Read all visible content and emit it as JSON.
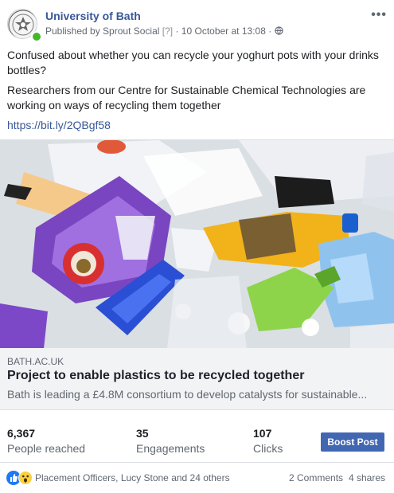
{
  "header": {
    "page_name": "University of Bath",
    "published_by": "Published by Sprout Social",
    "help_marker": "[?]",
    "separator": "·",
    "date": "10 October at 13:08",
    "audience_icon": "globe-icon",
    "more_label": "•••"
  },
  "post": {
    "paragraph1": "Confused about whether you can recycle your yoghurt pots with your drinks bottles?",
    "paragraph2": "Researchers from our Centre for Sustainable Chemical Technologies are working on ways of recycling them together",
    "link": "https://bit.ly/2QBgf58"
  },
  "link_preview": {
    "domain": "BATH.AC.UK",
    "title": "Project to enable plastics to be recycled together",
    "description": "Bath is leading a £4.8M consortium to develop catalysts for sustainable..."
  },
  "stats": [
    {
      "number": "6,367",
      "label": "People reached"
    },
    {
      "number": "35",
      "label": "Engagements"
    },
    {
      "number": "107",
      "label": "Clicks"
    }
  ],
  "boost_label": "Boost Post",
  "reactions": {
    "icons": [
      "like-icon",
      "wow-icon"
    ],
    "names": "Placement Officers, Lucy Stone and 24 others",
    "comments": "2 Comments",
    "shares": "4 shares"
  },
  "colors": {
    "link": "#385898",
    "boost": "#4267b2",
    "online": "#42b72a"
  }
}
